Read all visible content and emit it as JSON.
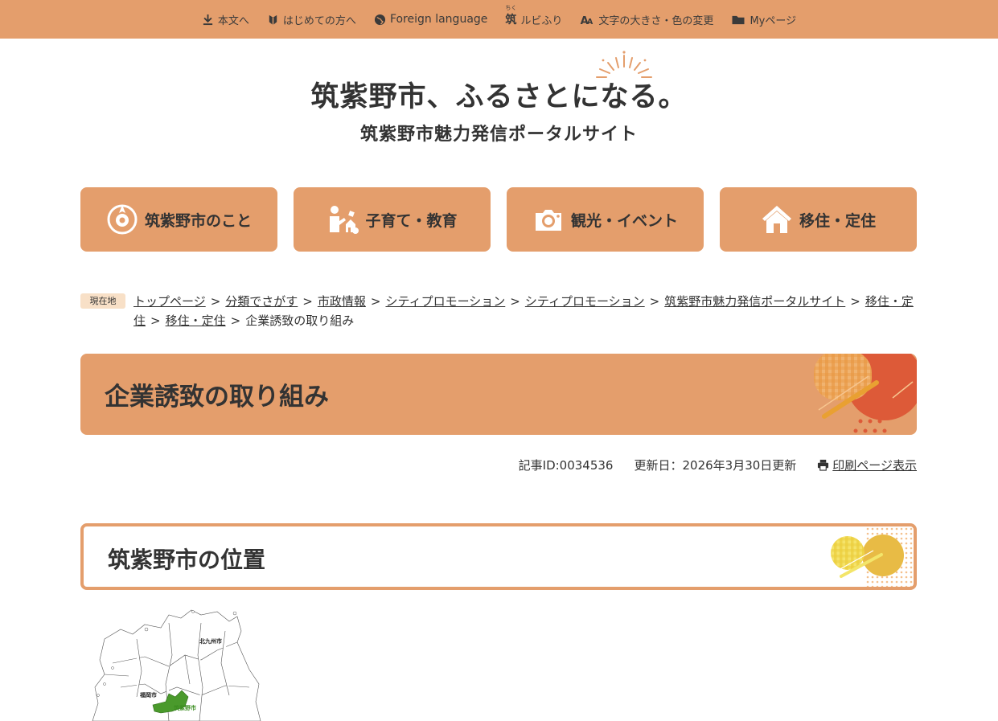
{
  "topbar": {
    "items": [
      {
        "label": "本文へ",
        "icon": "download-icon"
      },
      {
        "label": "はじめての方へ",
        "icon": "beginner-mark-icon"
      },
      {
        "label": "Foreign language",
        "icon": "globe-icon"
      },
      {
        "label": "ルビふり",
        "icon": "ruby-icon",
        "kanji": "筑",
        "ruby": "ちく"
      },
      {
        "label": "文字の大きさ・色の変更",
        "icon": "text-size-icon"
      },
      {
        "label": "Myページ",
        "icon": "folder-icon"
      }
    ]
  },
  "logo": {
    "main": "筑紫野市、ふるさとになる。",
    "sub": "筑紫野市魅力発信ポータルサイト"
  },
  "gnav": [
    {
      "label": "筑紫野市のこと",
      "icon": "city-emblem-icon"
    },
    {
      "label": "子育て・教育",
      "icon": "child-icon"
    },
    {
      "label": "観光・イベント",
      "icon": "camera-icon"
    },
    {
      "label": "移住・定住",
      "icon": "house-icon"
    }
  ],
  "breadcrumb": {
    "badge": "現在地",
    "links": [
      "トップページ",
      "分類でさがす",
      "市政情報",
      "シティプロモーション",
      "シティプロモーション",
      "筑紫野市魅力発信ポータルサイト",
      "移住・定住",
      "移住・定住"
    ],
    "current": "企業誘致の取り組み",
    "separator": ">"
  },
  "page": {
    "title": "企業誘致の取り組み",
    "article_id": "記事ID:0034536",
    "updated": "更新日：2026年3月30日更新",
    "print_label": "印刷ページ表示"
  },
  "section": {
    "title": "筑紫野市の位置"
  },
  "map": {
    "labels": [
      "北九州市",
      "福岡市",
      "筑紫野市"
    ]
  },
  "colors": {
    "accent": "#e49e6c",
    "badge_bg": "#f8e0c7",
    "highlight_green": "#4a9a2c"
  }
}
